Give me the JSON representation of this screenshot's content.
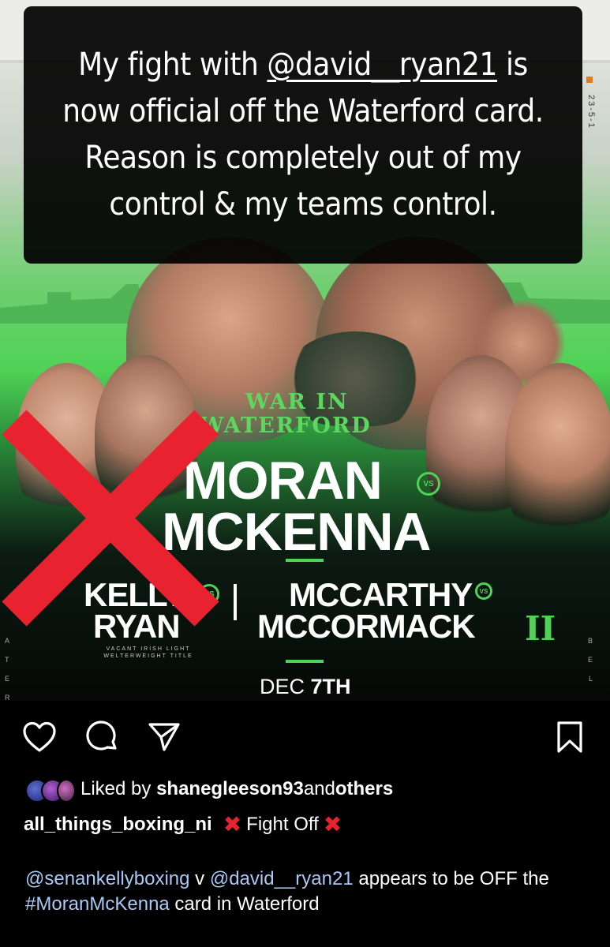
{
  "story_caption": {
    "prefix": "My fight with ",
    "mention": "@david__ryan21",
    "rest": " is now official off the Waterford card. Reason is completely out of my control & my teams control."
  },
  "poster": {
    "event_line1": "WAR IN",
    "event_line2": "WATERFORD",
    "headline_1": "MORAN",
    "headline_2": "MCKENNA",
    "vs_label": "VS",
    "undercard_left_1": "KELLY",
    "undercard_left_2": "RYAN",
    "undercard_right_1": "MCCARTHY",
    "undercard_right_2": "MCCORMACK",
    "undercard_right_suffix": "II",
    "title_note": "VACANT IRISH LIGHT WELTERWEIGHT TITLE",
    "date_prefix": "DEC ",
    "date_day": "7TH",
    "edge_text": "23-5-1",
    "side_left": [
      "A",
      "T",
      "E",
      "R"
    ],
    "side_right": [
      "B",
      "E",
      "L"
    ]
  },
  "actions": {
    "like_icon": "heart-icon",
    "comment_icon": "comment-icon",
    "share_icon": "paper-plane-icon",
    "save_icon": "bookmark-icon"
  },
  "likes": {
    "prefix": "Liked by ",
    "user": "shanegleeson93",
    "middle": " and ",
    "others": "others"
  },
  "post": {
    "username": "all_things_boxing_ni",
    "caption": "Fight Off",
    "mention_1": "@senankellyboxing",
    "v": " v ",
    "mention_2": "@david__ryan21",
    "mid_text": " appears to be OFF the ",
    "hashtag": "#MoranMcKenna",
    "end_text": " card in Waterford"
  },
  "colors": {
    "accent_green": "#4fd256",
    "cross_red": "#e8232f",
    "link_blue": "#a9c8f5"
  }
}
